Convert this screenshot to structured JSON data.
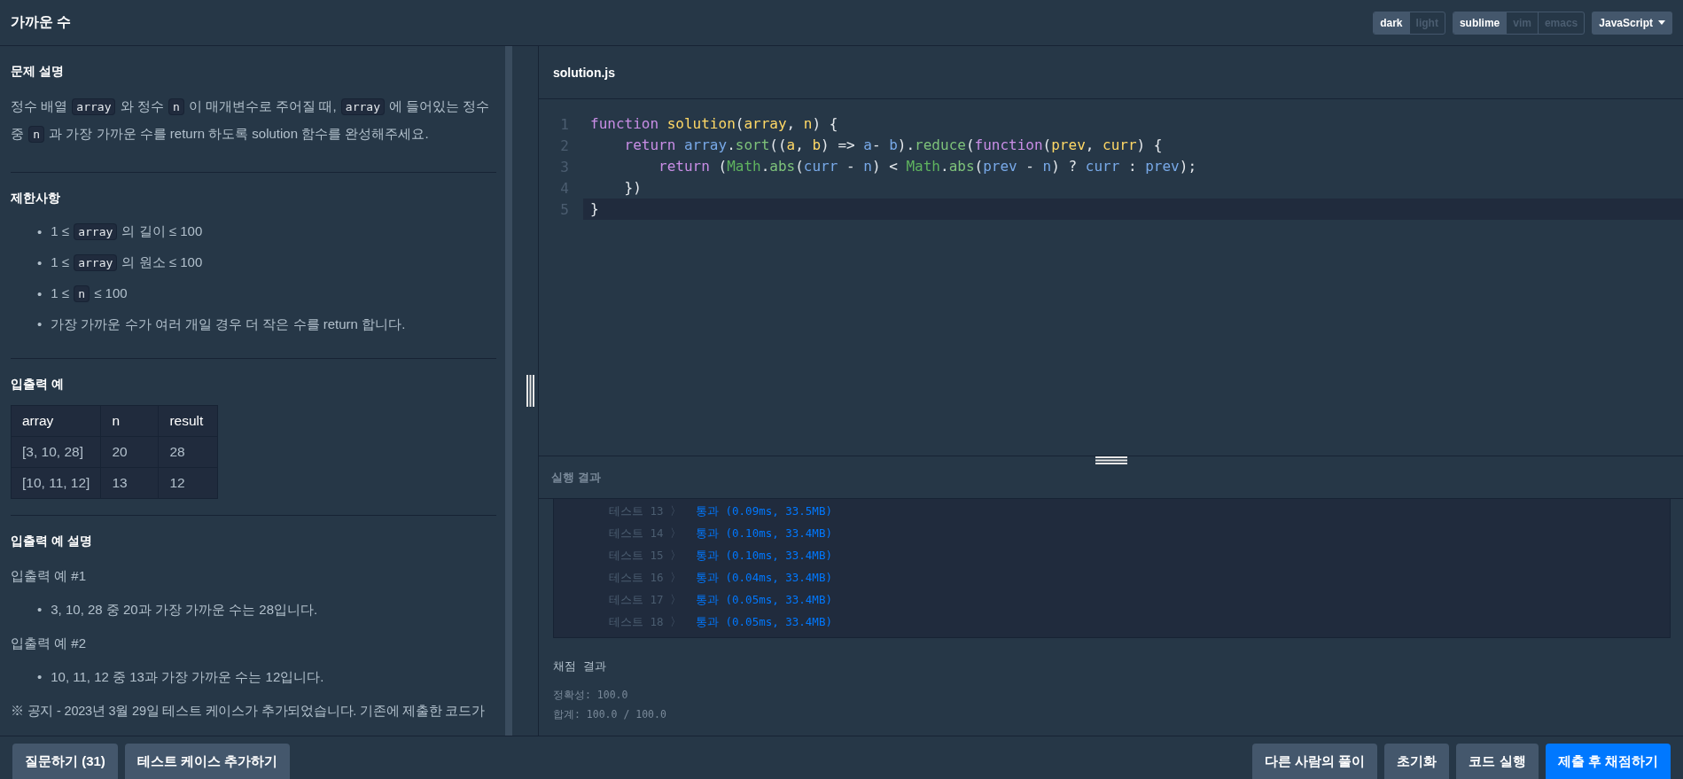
{
  "header": {
    "title": "가까운 수",
    "themes": [
      {
        "label": "dark",
        "selected": true
      },
      {
        "label": "light",
        "selected": false
      }
    ],
    "keymaps": [
      {
        "label": "sublime",
        "selected": true
      },
      {
        "label": "vim",
        "selected": false
      },
      {
        "label": "emacs",
        "selected": false
      }
    ],
    "language": "JavaScript"
  },
  "problem": {
    "sections": [
      {
        "title": "문제 설명",
        "blocks": [
          {
            "kind": "paragraph",
            "segments": [
              {
                "kind": "text",
                "text": "정수 배열 "
              },
              {
                "kind": "code",
                "text": "array"
              },
              {
                "kind": "text",
                "text": " 와 정수 "
              },
              {
                "kind": "code",
                "text": "n"
              },
              {
                "kind": "text",
                "text": " 이 매개변수로 주어질 때, "
              },
              {
                "kind": "code",
                "text": "array"
              },
              {
                "kind": "text",
                "text": " 에 들어있는 정수 중 "
              },
              {
                "kind": "code",
                "text": "n"
              },
              {
                "kind": "text",
                "text": " 과 가장 가까운 수를 return 하도록 solution 함수를 완성해주세요."
              }
            ]
          }
        ]
      },
      {
        "title": "제한사항",
        "blocks": [
          {
            "kind": "bullets",
            "items": [
              {
                "marker": "•",
                "segments": [
                  {
                    "kind": "text",
                    "text": "1 ≤ "
                  },
                  {
                    "kind": "code",
                    "text": "array"
                  },
                  {
                    "kind": "text",
                    "text": " 의 길이 ≤ 100"
                  }
                ]
              },
              {
                "marker": "•",
                "segments": [
                  {
                    "kind": "text",
                    "text": "1 ≤ "
                  },
                  {
                    "kind": "code",
                    "text": "array"
                  },
                  {
                    "kind": "text",
                    "text": " 의 원소 ≤ 100"
                  }
                ]
              },
              {
                "marker": "•",
                "segments": [
                  {
                    "kind": "text",
                    "text": "1 ≤ "
                  },
                  {
                    "kind": "code",
                    "text": "n"
                  },
                  {
                    "kind": "text",
                    "text": " ≤ 100"
                  }
                ]
              },
              {
                "marker": "•",
                "segments": [
                  {
                    "kind": "text",
                    "text": "가장 가까운 수가 여러 개일 경우 더 작은 수를 return 합니다."
                  }
                ]
              }
            ]
          }
        ]
      },
      {
        "title": "입출력 예",
        "blocks": [
          {
            "kind": "table",
            "columns": [
              "array",
              "n",
              "result"
            ],
            "rows": [
              [
                "[3, 10, 28]",
                "20",
                "28"
              ],
              [
                "[10, 11, 12]",
                "13",
                "12"
              ]
            ]
          }
        ]
      },
      {
        "title": "입출력 예 설명",
        "blocks": [
          {
            "kind": "paragraph",
            "segments": [
              {
                "kind": "text",
                "text": "입출력 예 #1"
              }
            ]
          },
          {
            "kind": "bullets",
            "items": [
              {
                "marker": "•",
                "segments": [
                  {
                    "kind": "text",
                    "text": "3, 10, 28 중 20과 가장 가까운 수는 28입니다."
                  }
                ]
              }
            ]
          },
          {
            "kind": "paragraph",
            "segments": [
              {
                "kind": "text",
                "text": "입출력 예 #2"
              }
            ]
          },
          {
            "kind": "bullets",
            "items": [
              {
                "marker": "•",
                "segments": [
                  {
                    "kind": "text",
                    "text": "10, 11, 12 중 13과 가장 가까운 수는 12입니다."
                  }
                ]
              }
            ]
          },
          {
            "kind": "notice",
            "segments": [
              {
                "kind": "text",
                "text": "※ 공지 - 2023년 3월 29일 테스트 케이스가 추가되었습니다. 기존에 제출한 코드가"
              }
            ]
          }
        ]
      }
    ]
  },
  "editor": {
    "filename": "solution.js",
    "lines": [
      {
        "number": "1",
        "active": false,
        "tokens": [
          {
            "kind": "keyword",
            "text": "function"
          },
          {
            "kind": "def",
            "text": " solution"
          },
          {
            "kind": "punct",
            "text": "("
          },
          {
            "kind": "def",
            "text": "array"
          },
          {
            "kind": "punct",
            "text": ", "
          },
          {
            "kind": "def",
            "text": "n"
          },
          {
            "kind": "punct",
            "text": ") {"
          }
        ]
      },
      {
        "number": "2",
        "active": false,
        "tokens": [
          {
            "kind": "keyword",
            "text": "    return"
          },
          {
            "kind": "var",
            "text": " array"
          },
          {
            "kind": "punct",
            "text": "."
          },
          {
            "kind": "method",
            "text": "sort"
          },
          {
            "kind": "punct",
            "text": "(("
          },
          {
            "kind": "def",
            "text": "a"
          },
          {
            "kind": "punct",
            "text": ", "
          },
          {
            "kind": "def",
            "text": "b"
          },
          {
            "kind": "punct",
            "text": ") => "
          },
          {
            "kind": "var",
            "text": "a"
          },
          {
            "kind": "punct",
            "text": "- "
          },
          {
            "kind": "var",
            "text": "b"
          },
          {
            "kind": "punct",
            "text": ")."
          },
          {
            "kind": "method",
            "text": "reduce"
          },
          {
            "kind": "punct",
            "text": "("
          },
          {
            "kind": "keyword",
            "text": "function"
          },
          {
            "kind": "punct",
            "text": "("
          },
          {
            "kind": "def",
            "text": "prev"
          },
          {
            "kind": "punct",
            "text": ", "
          },
          {
            "kind": "def",
            "text": "curr"
          },
          {
            "kind": "punct",
            "text": ") {"
          }
        ]
      },
      {
        "number": "3",
        "active": false,
        "tokens": [
          {
            "kind": "keyword",
            "text": "        return"
          },
          {
            "kind": "punct",
            "text": " ("
          },
          {
            "kind": "builtin",
            "text": "Math"
          },
          {
            "kind": "punct",
            "text": "."
          },
          {
            "kind": "method",
            "text": "abs"
          },
          {
            "kind": "punct",
            "text": "("
          },
          {
            "kind": "var",
            "text": "curr"
          },
          {
            "kind": "punct",
            "text": " - "
          },
          {
            "kind": "var",
            "text": "n"
          },
          {
            "kind": "punct",
            "text": ") < "
          },
          {
            "kind": "builtin",
            "text": "Math"
          },
          {
            "kind": "punct",
            "text": "."
          },
          {
            "kind": "method",
            "text": "abs"
          },
          {
            "kind": "punct",
            "text": "("
          },
          {
            "kind": "var",
            "text": "prev"
          },
          {
            "kind": "punct",
            "text": " - "
          },
          {
            "kind": "var",
            "text": "n"
          },
          {
            "kind": "punct",
            "text": ") ? "
          },
          {
            "kind": "var",
            "text": "curr"
          },
          {
            "kind": "punct",
            "text": " : "
          },
          {
            "kind": "var",
            "text": "prev"
          },
          {
            "kind": "punct",
            "text": ");"
          }
        ]
      },
      {
        "number": "4",
        "active": false,
        "tokens": [
          {
            "kind": "punct",
            "text": "    })"
          }
        ]
      },
      {
        "number": "5",
        "active": true,
        "tokens": [
          {
            "kind": "punct",
            "text": "}"
          }
        ]
      }
    ]
  },
  "results": {
    "title": "실행 결과",
    "tests": [
      {
        "label": "테스트 13 〉",
        "result": "통과 (0.09ms, 33.5MB)",
        "passed": true
      },
      {
        "label": "테스트 14 〉",
        "result": "통과 (0.10ms, 33.4MB)",
        "passed": true
      },
      {
        "label": "테스트 15 〉",
        "result": "통과 (0.10ms, 33.4MB)",
        "passed": true
      },
      {
        "label": "테스트 16 〉",
        "result": "통과 (0.04ms, 33.4MB)",
        "passed": true
      },
      {
        "label": "테스트 17 〉",
        "result": "통과 (0.05ms, 33.4MB)",
        "passed": true
      },
      {
        "label": "테스트 18 〉",
        "result": "통과 (0.05ms, 33.4MB)",
        "passed": true
      }
    ],
    "grading_title": "채점 결과",
    "grading_lines": [
      "정확성: 100.0",
      "합계: 100.0 / 100.0"
    ]
  },
  "footer": {
    "left_buttons": [
      "질문하기 (31)",
      "테스트 케이스 추가하기"
    ],
    "right_buttons": [
      {
        "label": "다른 사람의 풀이",
        "kind": "secondary"
      },
      {
        "label": "초기화",
        "kind": "secondary"
      },
      {
        "label": "코드 실행",
        "kind": "secondary"
      },
      {
        "label": "제출 후 채점하기",
        "kind": "primary"
      }
    ]
  }
}
